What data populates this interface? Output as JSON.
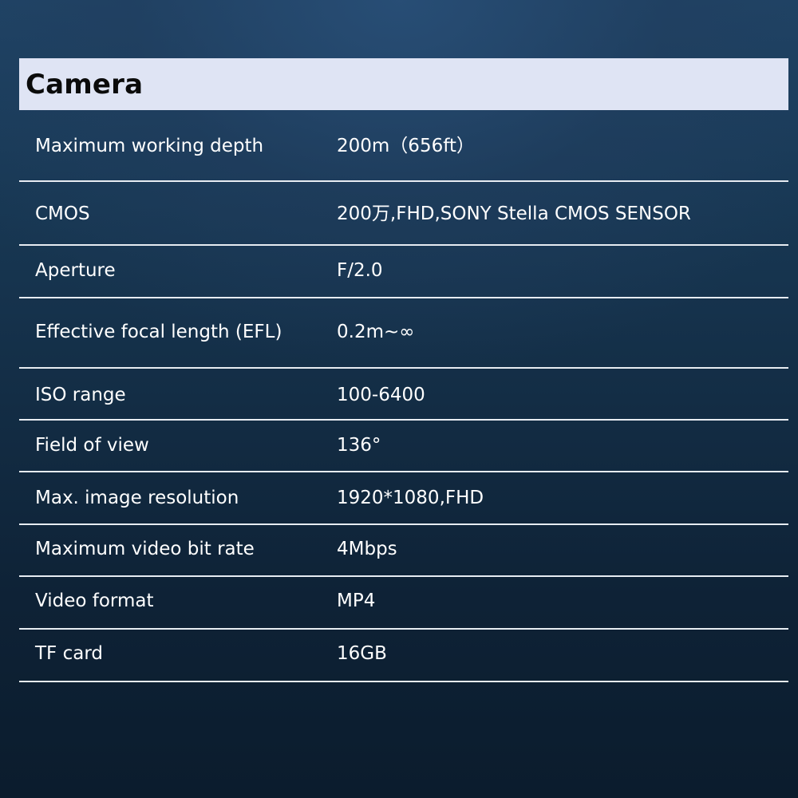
{
  "section": {
    "title": "Camera"
  },
  "specs": [
    {
      "label": "Maximum working depth",
      "value": "200m（656ft）"
    },
    {
      "label": "CMOS",
      "value": "200万,FHD,SONY Stella CMOS SENSOR"
    },
    {
      "label": "Aperture",
      "value": "F/2.0"
    },
    {
      "label": "Effective focal length (EFL)",
      "value": "0.2m~∞"
    },
    {
      "label": "ISO range",
      "value": "100-6400"
    },
    {
      "label": "Field of view",
      "value": "136°"
    },
    {
      "label": "Max. image resolution",
      "value": "1920*1080,FHD"
    },
    {
      "label": "Maximum video bit rate",
      "value": "4Mbps"
    },
    {
      "label": "Video format",
      "value": "MP4"
    },
    {
      "label": "TF card",
      "value": "16GB"
    }
  ]
}
